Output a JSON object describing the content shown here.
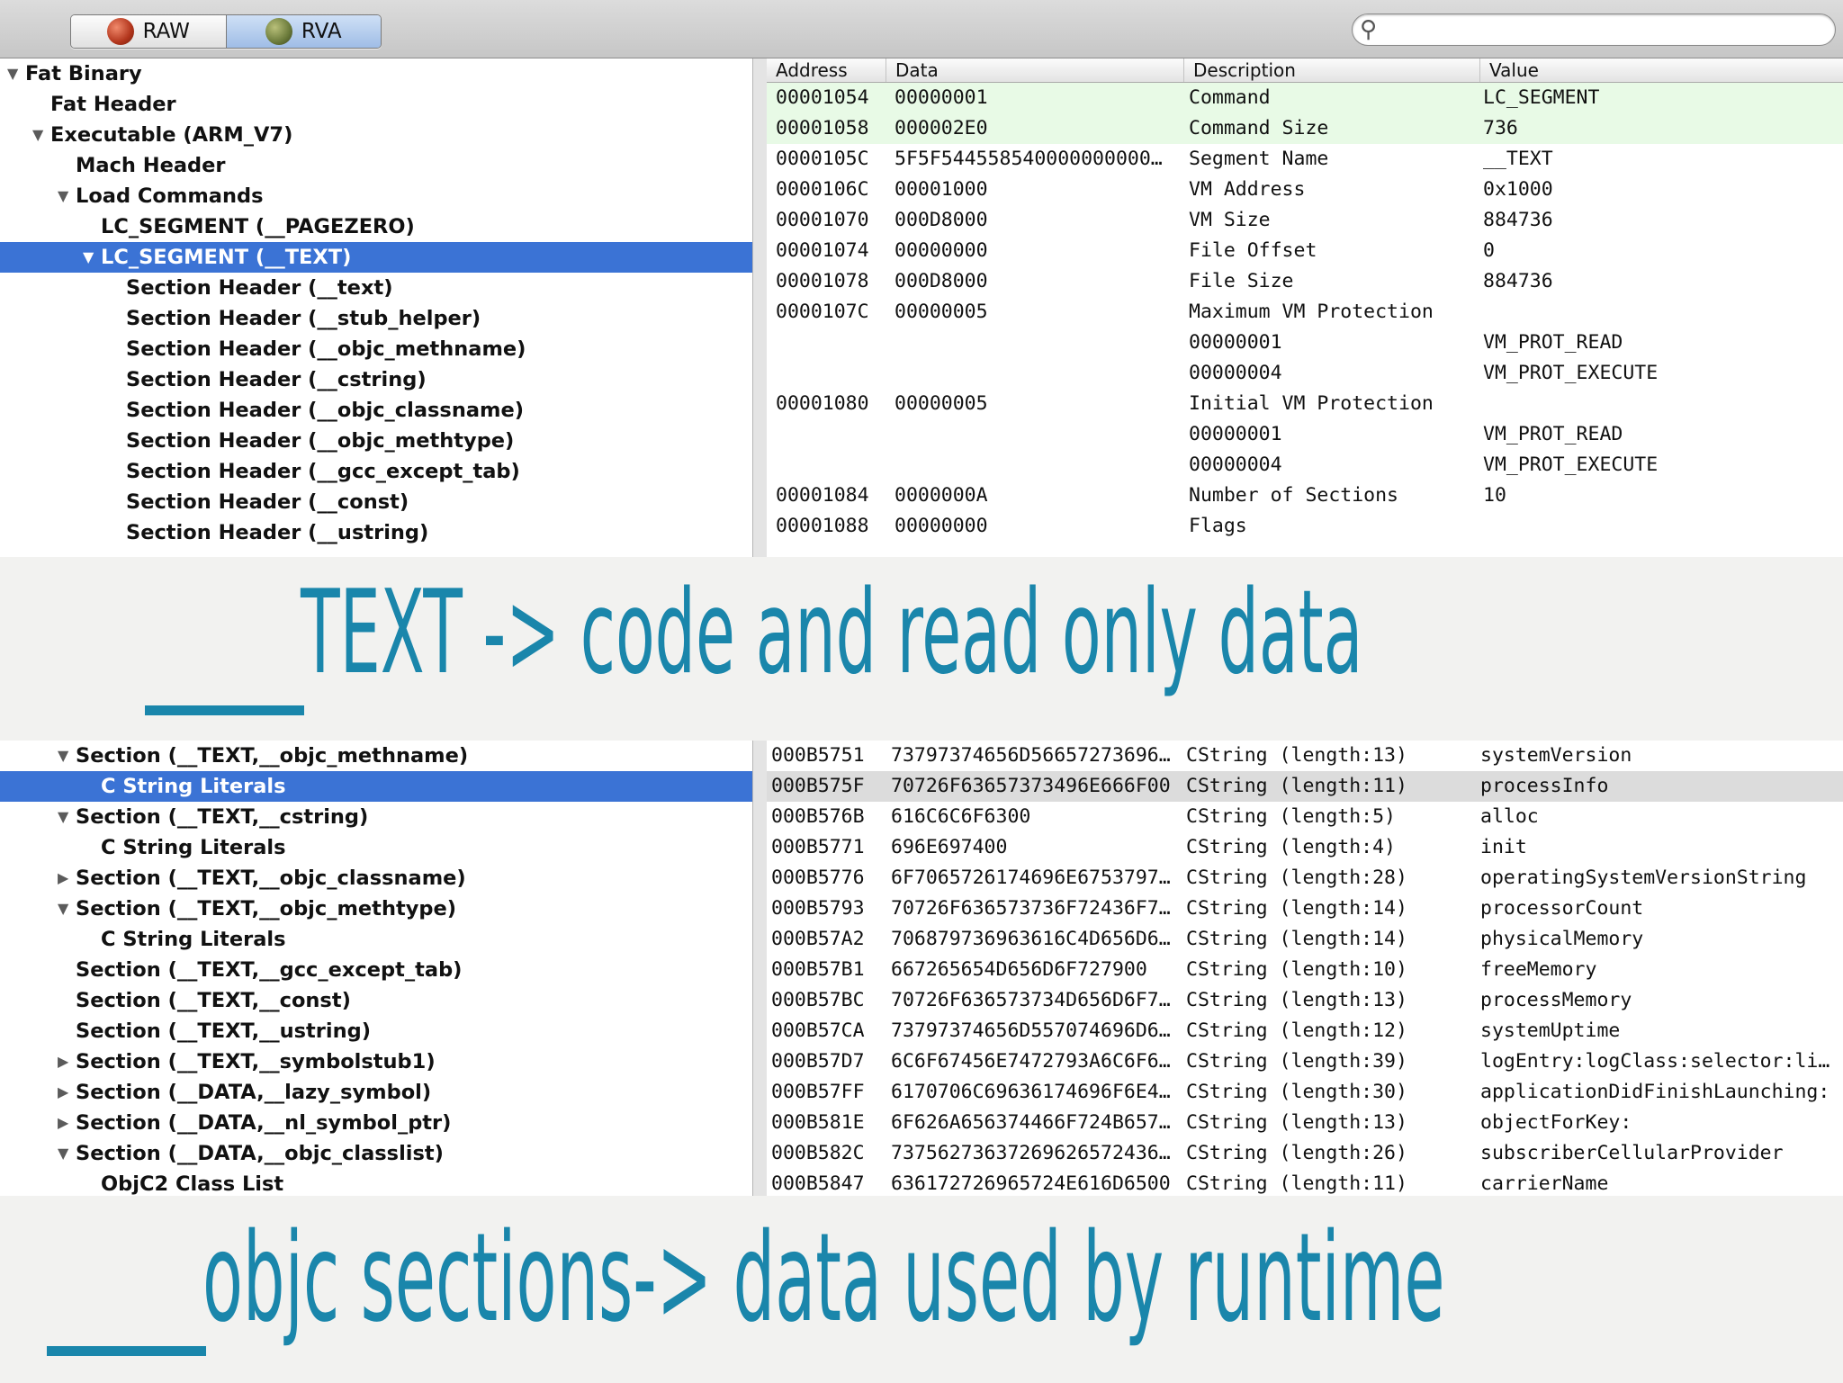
{
  "toolbar": {
    "raw_label": "RAW",
    "rva_label": "RVA",
    "search_placeholder": ""
  },
  "tree_top": [
    {
      "label": "Fat Binary",
      "indent": 0,
      "twisty": "open",
      "selected": false
    },
    {
      "label": "Fat Header",
      "indent": 1,
      "twisty": "none",
      "selected": false
    },
    {
      "label": "Executable  (ARM_V7)",
      "indent": 1,
      "twisty": "open",
      "selected": false
    },
    {
      "label": "Mach Header",
      "indent": 2,
      "twisty": "none",
      "selected": false
    },
    {
      "label": "Load Commands",
      "indent": 2,
      "twisty": "open",
      "selected": false
    },
    {
      "label": "LC_SEGMENT (__PAGEZERO)",
      "indent": 3,
      "twisty": "none",
      "selected": false
    },
    {
      "label": "LC_SEGMENT (__TEXT)",
      "indent": 3,
      "twisty": "open",
      "selected": true
    },
    {
      "label": "Section Header (__text)",
      "indent": 4,
      "twisty": "none",
      "selected": false
    },
    {
      "label": "Section Header (__stub_helper)",
      "indent": 4,
      "twisty": "none",
      "selected": false
    },
    {
      "label": "Section Header (__objc_methname)",
      "indent": 4,
      "twisty": "none",
      "selected": false
    },
    {
      "label": "Section Header (__cstring)",
      "indent": 4,
      "twisty": "none",
      "selected": false
    },
    {
      "label": "Section Header (__objc_classname)",
      "indent": 4,
      "twisty": "none",
      "selected": false
    },
    {
      "label": "Section Header (__objc_methtype)",
      "indent": 4,
      "twisty": "none",
      "selected": false
    },
    {
      "label": "Section Header (__gcc_except_tab)",
      "indent": 4,
      "twisty": "none",
      "selected": false
    },
    {
      "label": "Section Header (__const)",
      "indent": 4,
      "twisty": "none",
      "selected": false
    },
    {
      "label": "Section Header (__ustring)",
      "indent": 4,
      "twisty": "none",
      "selected": false
    }
  ],
  "table_top": {
    "headers": [
      "Address",
      "Data",
      "Description",
      "Value"
    ],
    "rows": [
      {
        "address": "00001054",
        "data": "00000001",
        "description": "Command",
        "value": "LC_SEGMENT",
        "hl": "green"
      },
      {
        "address": "00001058",
        "data": "000002E0",
        "description": "Command Size",
        "value": "736",
        "hl": "green"
      },
      {
        "address": "0000105C",
        "data": "5F5F544558540000000000…",
        "description": "Segment Name",
        "value": "__TEXT",
        "hl": ""
      },
      {
        "address": "0000106C",
        "data": "00001000",
        "description": "VM Address",
        "value": "0x1000",
        "hl": ""
      },
      {
        "address": "00001070",
        "data": "000D8000",
        "description": "VM Size",
        "value": "884736",
        "hl": ""
      },
      {
        "address": "00001074",
        "data": "00000000",
        "description": "File Offset",
        "value": "0",
        "hl": ""
      },
      {
        "address": "00001078",
        "data": "000D8000",
        "description": "File Size",
        "value": "884736",
        "hl": ""
      },
      {
        "address": "0000107C",
        "data": "00000005",
        "description": "Maximum VM Protection",
        "value": "",
        "hl": ""
      },
      {
        "address": "",
        "data": "",
        "description": "00000001",
        "value": "VM_PROT_READ",
        "hl": ""
      },
      {
        "address": "",
        "data": "",
        "description": "00000004",
        "value": "VM_PROT_EXECUTE",
        "hl": ""
      },
      {
        "address": "00001080",
        "data": "00000005",
        "description": "Initial VM Protection",
        "value": "",
        "hl": ""
      },
      {
        "address": "",
        "data": "",
        "description": "00000001",
        "value": "VM_PROT_READ",
        "hl": ""
      },
      {
        "address": "",
        "data": "",
        "description": "00000004",
        "value": "VM_PROT_EXECUTE",
        "hl": ""
      },
      {
        "address": "00001084",
        "data": "0000000A",
        "description": "Number of Sections",
        "value": "10",
        "hl": ""
      },
      {
        "address": "00001088",
        "data": "00000000",
        "description": "Flags",
        "value": "",
        "hl": ""
      }
    ]
  },
  "caption_top": "TEXT -> code and read only data",
  "tree_bot": [
    {
      "label": "Section (__TEXT,__objc_methname)",
      "indent": 2,
      "twisty": "open",
      "selected": false
    },
    {
      "label": "C String Literals",
      "indent": 3,
      "twisty": "none",
      "selected": true
    },
    {
      "label": "Section (__TEXT,__cstring)",
      "indent": 2,
      "twisty": "open",
      "selected": false
    },
    {
      "label": "C String Literals",
      "indent": 3,
      "twisty": "none",
      "selected": false
    },
    {
      "label": "Section (__TEXT,__objc_classname)",
      "indent": 2,
      "twisty": "closed",
      "selected": false
    },
    {
      "label": "Section (__TEXT,__objc_methtype)",
      "indent": 2,
      "twisty": "open",
      "selected": false
    },
    {
      "label": "C String Literals",
      "indent": 3,
      "twisty": "none",
      "selected": false
    },
    {
      "label": "Section (__TEXT,__gcc_except_tab)",
      "indent": 2,
      "twisty": "none",
      "selected": false
    },
    {
      "label": "Section (__TEXT,__const)",
      "indent": 2,
      "twisty": "none",
      "selected": false
    },
    {
      "label": "Section (__TEXT,__ustring)",
      "indent": 2,
      "twisty": "none",
      "selected": false
    },
    {
      "label": "Section (__TEXT,__symbolstub1)",
      "indent": 2,
      "twisty": "closed",
      "selected": false
    },
    {
      "label": "Section (__DATA,__lazy_symbol)",
      "indent": 2,
      "twisty": "closed",
      "selected": false
    },
    {
      "label": "Section (__DATA,__nl_symbol_ptr)",
      "indent": 2,
      "twisty": "closed",
      "selected": false
    },
    {
      "label": "Section (__DATA,__objc_classlist)",
      "indent": 2,
      "twisty": "open",
      "selected": false
    },
    {
      "label": "ObjC2 Class List",
      "indent": 3,
      "twisty": "none",
      "selected": false
    }
  ],
  "table_bot": {
    "rows": [
      {
        "address": "000B5751",
        "data": "73797374656D56657273696…",
        "description": "CString (length:13)",
        "value": "systemVersion",
        "hl": ""
      },
      {
        "address": "000B575F",
        "data": "70726F63657373496E666F00",
        "description": "CString (length:11)",
        "value": "processInfo",
        "hl": "gray"
      },
      {
        "address": "000B576B",
        "data": "616C6C6F6300",
        "description": "CString (length:5)",
        "value": "alloc",
        "hl": ""
      },
      {
        "address": "000B5771",
        "data": "696E697400",
        "description": "CString (length:4)",
        "value": "init",
        "hl": ""
      },
      {
        "address": "000B5776",
        "data": "6F7065726174696E6753797…",
        "description": "CString (length:28)",
        "value": "operatingSystemVersionString",
        "hl": ""
      },
      {
        "address": "000B5793",
        "data": "70726F636573736F72436F7…",
        "description": "CString (length:14)",
        "value": "processorCount",
        "hl": ""
      },
      {
        "address": "000B57A2",
        "data": "706879736963616C4D656D6…",
        "description": "CString (length:14)",
        "value": "physicalMemory",
        "hl": ""
      },
      {
        "address": "000B57B1",
        "data": "667265654D656D6F727900",
        "description": "CString (length:10)",
        "value": "freeMemory",
        "hl": ""
      },
      {
        "address": "000B57BC",
        "data": "70726F636573734D656D6F7…",
        "description": "CString (length:13)",
        "value": "processMemory",
        "hl": ""
      },
      {
        "address": "000B57CA",
        "data": "73797374656D557074696D6…",
        "description": "CString (length:12)",
        "value": "systemUptime",
        "hl": ""
      },
      {
        "address": "000B57D7",
        "data": "6C6F67456E7472793A6C6F6…",
        "description": "CString (length:39)",
        "value": "logEntry:logClass:selector:li…",
        "hl": ""
      },
      {
        "address": "000B57FF",
        "data": "6170706C69636174696F6E4…",
        "description": "CString (length:30)",
        "value": "applicationDidFinishLaunching:",
        "hl": ""
      },
      {
        "address": "000B581E",
        "data": "6F626A656374466F724B657…",
        "description": "CString (length:13)",
        "value": "objectForKey:",
        "hl": ""
      },
      {
        "address": "000B582C",
        "data": "737562736372696265724365…",
        "description": "CString (length:26)",
        "value": "subscriberCellularProvider",
        "hl": ""
      },
      {
        "address": "000B5847",
        "data": "636172726965724E616D6500",
        "description": "CString (length:11)",
        "value": "carrierName",
        "hl": ""
      }
    ]
  },
  "caption_bot": "objc sections-> data used by runtime",
  "colors": {
    "selection": "#3b73d5",
    "caption": "#1a86ab",
    "highlight_green": "#e8fae6",
    "highlight_gray": "#dcdcdc"
  }
}
